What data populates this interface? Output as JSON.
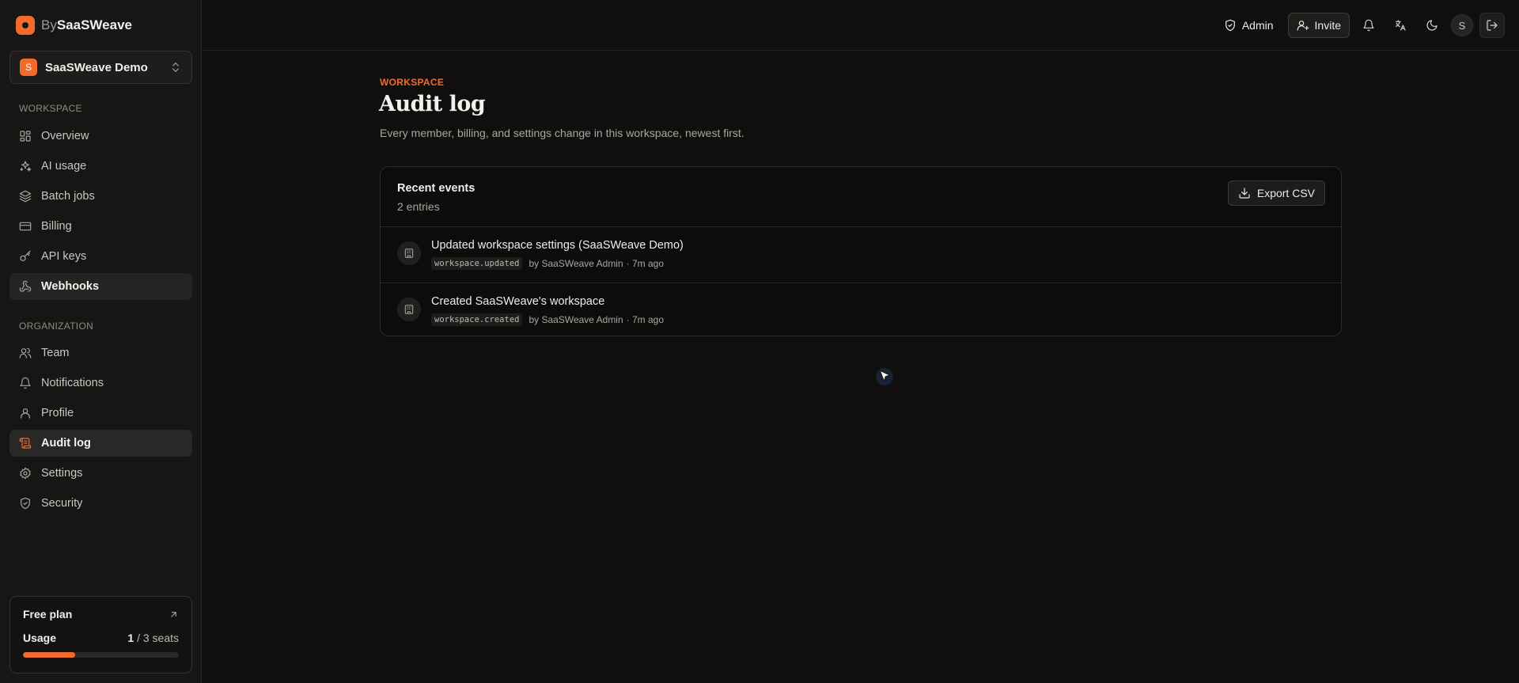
{
  "brand": {
    "prefix": "By",
    "name": "SaaSWeave"
  },
  "workspace_switcher": {
    "initial": "S",
    "name": "SaaSWeave Demo"
  },
  "sidebar": {
    "workspace_label": "WORKSPACE",
    "workspace_items": [
      {
        "label": "Overview",
        "icon": "grid-icon"
      },
      {
        "label": "AI usage",
        "icon": "sparkles-icon"
      },
      {
        "label": "Batch jobs",
        "icon": "layers-icon"
      },
      {
        "label": "Billing",
        "icon": "credit-card-icon"
      },
      {
        "label": "API keys",
        "icon": "key-icon"
      },
      {
        "label": "Webhooks",
        "icon": "webhook-icon"
      }
    ],
    "organization_label": "ORGANIZATION",
    "organization_items": [
      {
        "label": "Team",
        "icon": "users-icon"
      },
      {
        "label": "Notifications",
        "icon": "bell-icon"
      },
      {
        "label": "Profile",
        "icon": "user-icon"
      },
      {
        "label": "Audit log",
        "icon": "scroll-icon"
      },
      {
        "label": "Settings",
        "icon": "gear-icon"
      },
      {
        "label": "Security",
        "icon": "shield-icon"
      }
    ],
    "active_item": "Audit log"
  },
  "plan": {
    "title": "Free plan",
    "usage_label": "Usage",
    "used": "1",
    "separator": " / ",
    "total": "3 seats",
    "usage_fraction": 0.333
  },
  "topbar": {
    "admin_label": "Admin",
    "invite_label": "Invite",
    "avatar_initial": "S"
  },
  "page": {
    "eyebrow": "WORKSPACE",
    "title": "Audit log",
    "subtitle": "Every member, billing, and settings change in this workspace, newest first."
  },
  "events_card": {
    "title": "Recent events",
    "count": "2 entries",
    "export_label": "Export CSV",
    "events": [
      {
        "title": "Updated workspace settings (SaaSWeave Demo)",
        "code": "workspace.updated",
        "actor": "by SaaSWeave Admin",
        "time": "· 7m ago"
      },
      {
        "title": "Created SaaSWeave's workspace",
        "code": "workspace.created",
        "actor": "by SaaSWeave Admin",
        "time": "· 7m ago"
      }
    ]
  },
  "colors": {
    "accent": "#f26b2d",
    "background": "#100f0e",
    "sidebar": "#171614"
  }
}
